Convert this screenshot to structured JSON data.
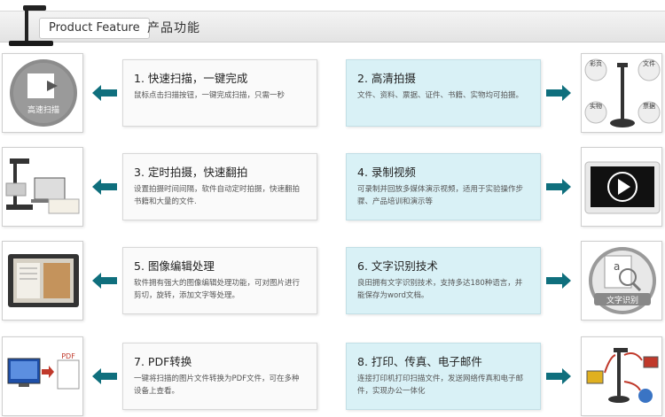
{
  "header": {
    "title_en": "Product Feature",
    "title_cn": "产品功能"
  },
  "features": [
    {
      "title": "1. 快速扫描，一键完成",
      "desc": "鼠标点击扫描按钮，一键完成扫描，只需一秒"
    },
    {
      "title": "2. 高清拍摄",
      "desc": "文件、资料、票据、证件、书籍、实物均可拍摄。"
    },
    {
      "title": "3. 定时拍摄，快速翻拍",
      "desc": "设置拍摄时间间隔，软件自动定时拍摄，快速翻拍书籍和大量的文件."
    },
    {
      "title": "4. 录制视频",
      "desc": "可录制并回放多媒体演示视频，适用于实验操作步骤、产品培训和演示等"
    },
    {
      "title": "5. 图像编辑处理",
      "desc": "软件拥有强大的图像编辑处理功能，可对图片进行剪切，旋转，添加文字等处理。"
    },
    {
      "title": "6. 文字识别技术",
      "desc": "良田拥有文字识别技术，支持多达180种语言，并能保存为word文档。"
    },
    {
      "title": "7. PDF转换",
      "desc": "一键将扫描的图片文件转换为PDF文件，可在多种设备上查看。"
    },
    {
      "title": "8. 打印、传真、电子邮件",
      "desc": "连接打印机打印扫描文件，发送网络传真和电子邮件，实现办公一体化"
    }
  ],
  "thumb_labels": {
    "fast_scan": "高速扫描",
    "ocr": "文字识别",
    "pdf": "PDF",
    "doc_types": [
      "彩页",
      "文件",
      "实物",
      "票据"
    ]
  },
  "colors": {
    "arrow": "#0f6f7d",
    "card_blue": "#d9f1f6",
    "card_gray": "#fafafa"
  }
}
